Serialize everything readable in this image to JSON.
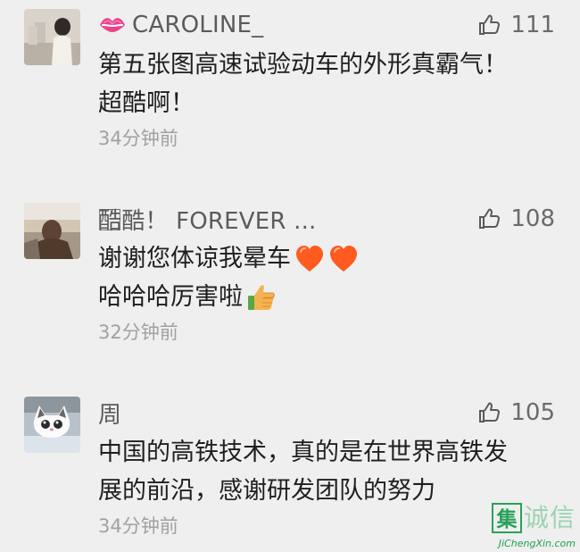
{
  "comments": [
    {
      "username": "CAROLINE_",
      "likes": "111",
      "lines": [
        "第五张图高速试验动车的外形真霸气！",
        "超酷啊！"
      ],
      "time": "34分钟前"
    },
    {
      "username": "酷⃞酷！ FOREVER ...",
      "likes": "108",
      "lines": [
        "谢谢您体谅我晕车",
        "哈哈哈厉害啦"
      ],
      "time": "32分钟前"
    },
    {
      "username": "周",
      "likes": "105",
      "lines": [
        "中国的高铁技术，真的是在世界高铁发",
        "展的前沿，感谢研发团队的努力"
      ],
      "time": "34分钟前"
    }
  ],
  "watermark": {
    "badge": "集",
    "text": "诚信",
    "url": "JiChengXin.com"
  },
  "icons": {
    "like": "thumbs-up-outline-icon",
    "lips": "lips-emoji-icon",
    "heart": "heart-emoji-icon",
    "thumb_emoji": "thumbs-up-emoji-icon"
  },
  "colors": {
    "background": "#efefef",
    "username": "#5b5b5b",
    "content": "#1f1f1f",
    "timestamp": "#a1a1a1",
    "heart": "#ff5a1f",
    "watermark": "#28a15a"
  }
}
